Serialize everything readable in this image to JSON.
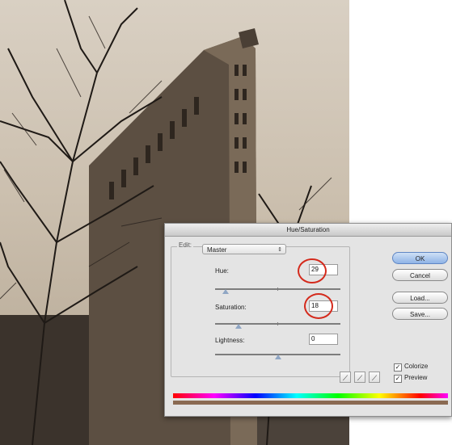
{
  "dialog": {
    "title": "Hue/Saturation",
    "edit_label": "Edit:",
    "edit_value": "Master",
    "hue_label": "Hue:",
    "hue_value": "29",
    "saturation_label": "Saturation:",
    "saturation_value": "18",
    "lightness_label": "Lightness:",
    "lightness_value": "0",
    "ok_label": "OK",
    "cancel_label": "Cancel",
    "load_label": "Load...",
    "save_label": "Save...",
    "colorize_label": "Colorize",
    "preview_label": "Preview",
    "colorize_checked": true,
    "preview_checked": true
  },
  "colors": {
    "highlight_circle": "#d42a1c",
    "sepia_result": "#8a6a52"
  },
  "icons": [
    "eyedropper-icon",
    "eyedropper-plus-icon",
    "eyedropper-minus-icon"
  ]
}
